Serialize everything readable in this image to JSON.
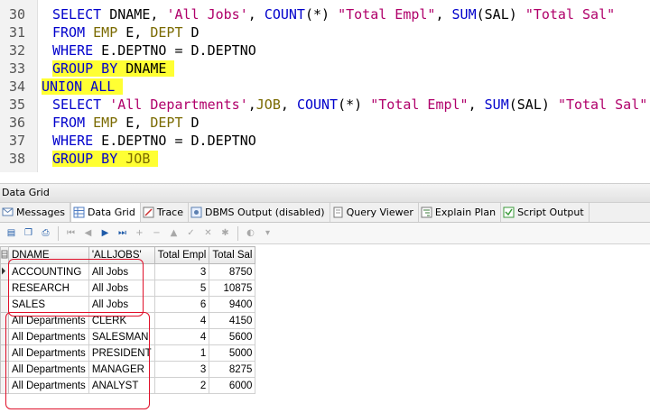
{
  "editor": {
    "lines": [
      {
        "num": "30",
        "tokens": [
          {
            "t": "SELECT",
            "c": "kw"
          },
          {
            "t": " DNAME, ",
            "c": ""
          },
          {
            "t": "'All Jobs'",
            "c": "str"
          },
          {
            "t": ", ",
            "c": ""
          },
          {
            "t": "COUNT",
            "c": "kw"
          },
          {
            "t": "(*) ",
            "c": ""
          },
          {
            "t": "\"Total Empl\"",
            "c": "str"
          },
          {
            "t": ", ",
            "c": ""
          },
          {
            "t": "SUM",
            "c": "kw"
          },
          {
            "t": "(SAL) ",
            "c": ""
          },
          {
            "t": "\"Total Sal\"",
            "c": "str"
          }
        ]
      },
      {
        "num": "31",
        "tokens": [
          {
            "t": "FROM",
            "c": "kw"
          },
          {
            "t": " ",
            "c": ""
          },
          {
            "t": "EMP",
            "c": "ident"
          },
          {
            "t": " E, ",
            "c": ""
          },
          {
            "t": "DEPT",
            "c": "ident"
          },
          {
            "t": " D",
            "c": ""
          }
        ]
      },
      {
        "num": "32",
        "tokens": [
          {
            "t": "WHERE",
            "c": "kw"
          },
          {
            "t": " E.DEPTNO = D.DEPTNO",
            "c": ""
          }
        ]
      },
      {
        "num": "33",
        "highlight": true,
        "tokens": [
          {
            "t": "GROUP BY",
            "c": "kw"
          },
          {
            "t": " DNAME",
            "c": ""
          }
        ]
      },
      {
        "num": "34",
        "highlight": true,
        "outdent": true,
        "tokens": [
          {
            "t": "UNION ALL",
            "c": "kw"
          }
        ]
      },
      {
        "num": "35",
        "tokens": [
          {
            "t": "SELECT",
            "c": "kw"
          },
          {
            "t": " ",
            "c": ""
          },
          {
            "t": "'All Departments'",
            "c": "str"
          },
          {
            "t": ",",
            "c": ""
          },
          {
            "t": "JOB",
            "c": "ident"
          },
          {
            "t": ", ",
            "c": ""
          },
          {
            "t": "COUNT",
            "c": "kw"
          },
          {
            "t": "(*) ",
            "c": ""
          },
          {
            "t": "\"Total Empl\"",
            "c": "str"
          },
          {
            "t": ", ",
            "c": ""
          },
          {
            "t": "SUM",
            "c": "kw"
          },
          {
            "t": "(SAL) ",
            "c": ""
          },
          {
            "t": "\"Total Sal\"",
            "c": "str"
          }
        ]
      },
      {
        "num": "36",
        "tokens": [
          {
            "t": "FROM",
            "c": "kw"
          },
          {
            "t": " ",
            "c": ""
          },
          {
            "t": "EMP",
            "c": "ident"
          },
          {
            "t": " E, ",
            "c": ""
          },
          {
            "t": "DEPT",
            "c": "ident"
          },
          {
            "t": " D",
            "c": ""
          }
        ]
      },
      {
        "num": "37",
        "tokens": [
          {
            "t": "WHERE",
            "c": "kw"
          },
          {
            "t": " E.DEPTNO = D.DEPTNO",
            "c": ""
          }
        ]
      },
      {
        "num": "38",
        "highlight": true,
        "tokens": [
          {
            "t": "GROUP BY",
            "c": "kw"
          },
          {
            "t": " ",
            "c": ""
          },
          {
            "t": "JOB",
            "c": "ident"
          }
        ]
      }
    ]
  },
  "pane": {
    "title": "Data Grid",
    "tabs": [
      {
        "label": "Messages",
        "icon": "messages-icon",
        "active": false
      },
      {
        "label": "Data Grid",
        "icon": "grid-icon",
        "active": true
      },
      {
        "label": "Trace",
        "icon": "trace-icon",
        "active": false
      },
      {
        "label": "DBMS Output (disabled)",
        "icon": "dbms-output-icon",
        "active": false
      },
      {
        "label": "Query Viewer",
        "icon": "query-viewer-icon",
        "active": false
      },
      {
        "label": "Explain Plan",
        "icon": "explain-plan-icon",
        "active": false
      },
      {
        "label": "Script Output",
        "icon": "script-output-icon",
        "active": false
      }
    ]
  },
  "toolbar": {
    "buttons": [
      {
        "icon": "export-icon",
        "glyph": "▤",
        "dim": false
      },
      {
        "icon": "copy-icon",
        "glyph": "❐",
        "dim": false
      },
      {
        "icon": "print-icon",
        "glyph": "⎙",
        "dim": false
      },
      {
        "sep": true
      },
      {
        "icon": "first-record-icon",
        "glyph": "⏮",
        "dim": true
      },
      {
        "icon": "prior-record-icon",
        "glyph": "◀",
        "dim": true
      },
      {
        "icon": "next-record-icon",
        "glyph": "▶",
        "dim": false
      },
      {
        "icon": "last-record-icon",
        "glyph": "⏭",
        "dim": false
      },
      {
        "icon": "insert-record-icon",
        "glyph": "+",
        "dim": true
      },
      {
        "icon": "delete-record-icon",
        "glyph": "−",
        "dim": true
      },
      {
        "icon": "edit-record-icon",
        "glyph": "▲",
        "dim": true
      },
      {
        "icon": "post-edit-icon",
        "glyph": "✓",
        "dim": true
      },
      {
        "icon": "cancel-edit-icon",
        "glyph": "✕",
        "dim": true
      },
      {
        "icon": "refresh-icon",
        "glyph": "✱",
        "dim": true
      },
      {
        "sep": true
      },
      {
        "icon": "filter-icon",
        "glyph": "◐",
        "dim": true
      },
      {
        "icon": "toolbar-dropdown-icon",
        "glyph": "▾",
        "dim": true
      }
    ]
  },
  "grid": {
    "columns": [
      "DNAME",
      "'ALLJOBS'",
      "Total Empl",
      "Total Sal"
    ],
    "rows": [
      [
        "ACCOUNTING",
        "All Jobs",
        "3",
        "8750"
      ],
      [
        "RESEARCH",
        "All Jobs",
        "5",
        "10875"
      ],
      [
        "SALES",
        "All Jobs",
        "6",
        "9400"
      ],
      [
        "All Departments",
        "CLERK",
        "4",
        "4150"
      ],
      [
        "All Departments",
        "SALESMAN",
        "4",
        "5600"
      ],
      [
        "All Departments",
        "PRESIDENT",
        "1",
        "5000"
      ],
      [
        "All Departments",
        "MANAGER",
        "3",
        "8275"
      ],
      [
        "All Departments",
        "ANALYST",
        "2",
        "6000"
      ]
    ]
  },
  "colors": {
    "highlight": "#ffff33",
    "annotation": "#e0102a",
    "keyword": "#0000cc",
    "string": "#b0006a"
  }
}
